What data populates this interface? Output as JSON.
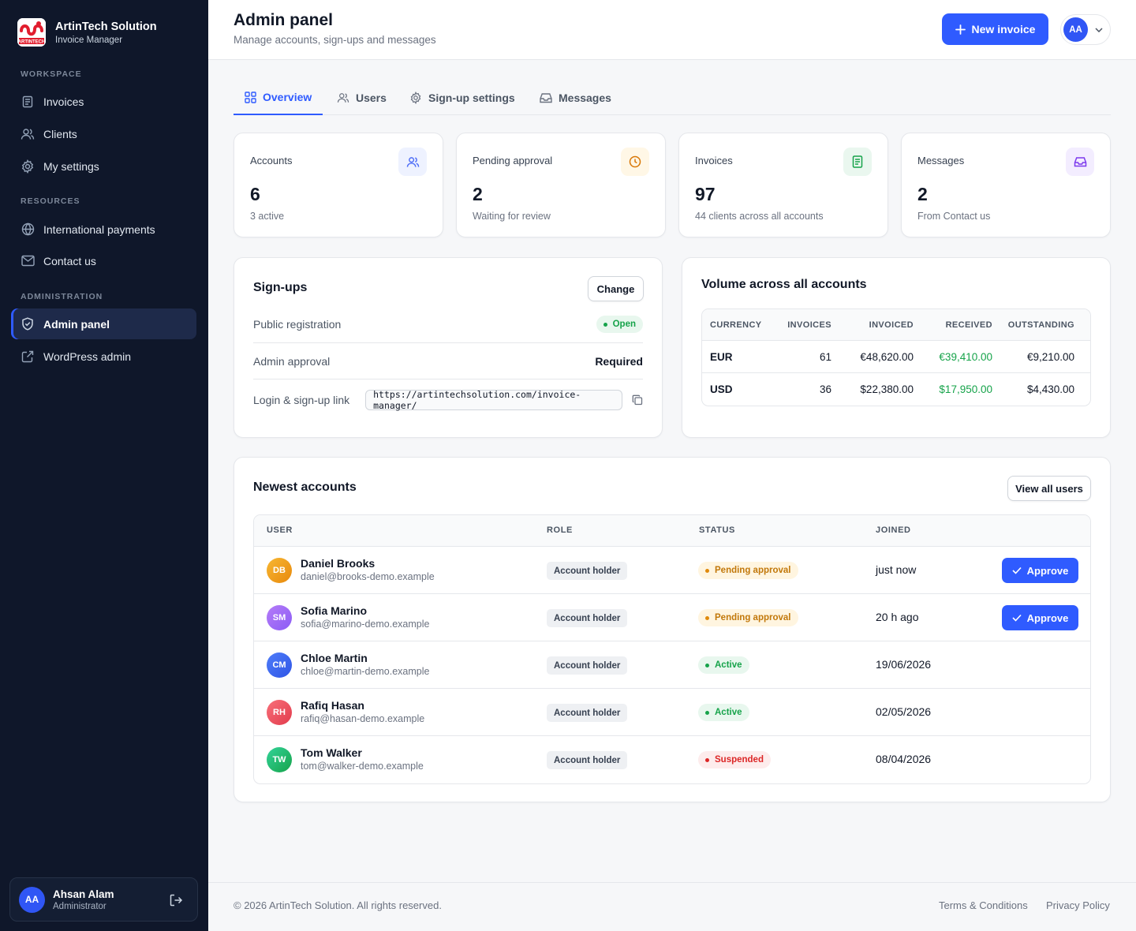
{
  "brand": {
    "name": "ArtinTech Solution",
    "subtitle": "Invoice Manager",
    "logo_text": "ARTINTECH"
  },
  "sidebar": {
    "sections": [
      "WORKSPACE",
      "RESOURCES",
      "ADMINISTRATION"
    ],
    "items": [
      {
        "label": "Invoices",
        "icon": "file-icon"
      },
      {
        "label": "Clients",
        "icon": "users-icon"
      },
      {
        "label": "My settings",
        "icon": "gear-icon"
      },
      {
        "label": "International payments",
        "icon": "globe-icon"
      },
      {
        "label": "Contact us",
        "icon": "mail-icon"
      },
      {
        "label": "Admin panel",
        "icon": "shield-icon",
        "active": true
      },
      {
        "label": "WordPress admin",
        "icon": "external-link-icon"
      }
    ],
    "user": {
      "initials": "AA",
      "name": "Ahsan Alam",
      "role": "Administrator"
    }
  },
  "header": {
    "title": "Admin panel",
    "subtitle": "Manage accounts, sign-ups and messages",
    "new_invoice": "New invoice",
    "avatar_initials": "AA"
  },
  "tabs": [
    "Overview",
    "Users",
    "Sign-up settings",
    "Messages"
  ],
  "stats": [
    {
      "label": "Accounts",
      "value": "6",
      "sub": "3 active",
      "color": "#4f6ef7",
      "bg": "#eef2ff"
    },
    {
      "label": "Pending approval",
      "value": "2",
      "sub": "Waiting for review",
      "color": "#d97706",
      "bg": "#fff7e6"
    },
    {
      "label": "Invoices",
      "value": "97",
      "sub": "44 clients across all accounts",
      "color": "#16a34a",
      "bg": "#eaf7ef"
    },
    {
      "label": "Messages",
      "value": "2",
      "sub": "From Contact us",
      "color": "#7c3aed",
      "bg": "#f3edff"
    }
  ],
  "signups": {
    "title": "Sign-ups",
    "change": "Change",
    "public_registration_label": "Public registration",
    "public_registration_value": "Open",
    "admin_approval_label": "Admin approval",
    "admin_approval_value": "Required",
    "link_label": "Login & sign-up link",
    "link_value": "https://artintechsolution.com/invoice-manager/"
  },
  "volume": {
    "title": "Volume across all accounts",
    "columns": [
      "CURRENCY",
      "INVOICES",
      "INVOICED",
      "RECEIVED",
      "OUTSTANDING"
    ],
    "rows": [
      {
        "currency": "EUR",
        "invoices": "61",
        "invoiced": "€48,620.00",
        "received": "€39,410.00",
        "outstanding": "€9,210.00"
      },
      {
        "currency": "USD",
        "invoices": "36",
        "invoiced": "$22,380.00",
        "received": "$17,950.00",
        "outstanding": "$4,430.00"
      }
    ]
  },
  "accounts": {
    "title": "Newest accounts",
    "view_all": "View all users",
    "columns": [
      "USER",
      "ROLE",
      "STATUS",
      "JOINED"
    ],
    "approve_label": "Approve",
    "rows": [
      {
        "initials": "DB",
        "name": "Daniel Brooks",
        "email": "daniel@brooks-demo.example",
        "role": "Account holder",
        "status": "Pending approval",
        "joined": "just now",
        "avatar_color": "#f59e0b"
      },
      {
        "initials": "SM",
        "name": "Sofia Marino",
        "email": "sofia@marino-demo.example",
        "role": "Account holder",
        "status": "Pending approval",
        "joined": "20 h ago",
        "avatar_color": "#a855f7"
      },
      {
        "initials": "CM",
        "name": "Chloe Martin",
        "email": "chloe@martin-demo.example",
        "role": "Account holder",
        "status": "Active",
        "joined": "19/06/2026",
        "avatar_color": "#3b5bf5"
      },
      {
        "initials": "RH",
        "name": "Rafiq Hasan",
        "email": "rafiq@hasan-demo.example",
        "role": "Account holder",
        "status": "Active",
        "joined": "02/05/2026",
        "avatar_color": "#ef4444"
      },
      {
        "initials": "TW",
        "name": "Tom Walker",
        "email": "tom@walker-demo.example",
        "role": "Account holder",
        "status": "Suspended",
        "joined": "08/04/2026",
        "avatar_color": "#22c55e"
      }
    ]
  },
  "footer": {
    "copyright": "© 2026 ArtinTech Solution. All rights reserved.",
    "terms": "Terms & Conditions",
    "privacy": "Privacy Policy"
  },
  "colors": {
    "primary": "#2f5bff",
    "sidebar": "#0f172a",
    "success": "#16a34a",
    "warning": "#d97706",
    "danger": "#dc2626"
  }
}
